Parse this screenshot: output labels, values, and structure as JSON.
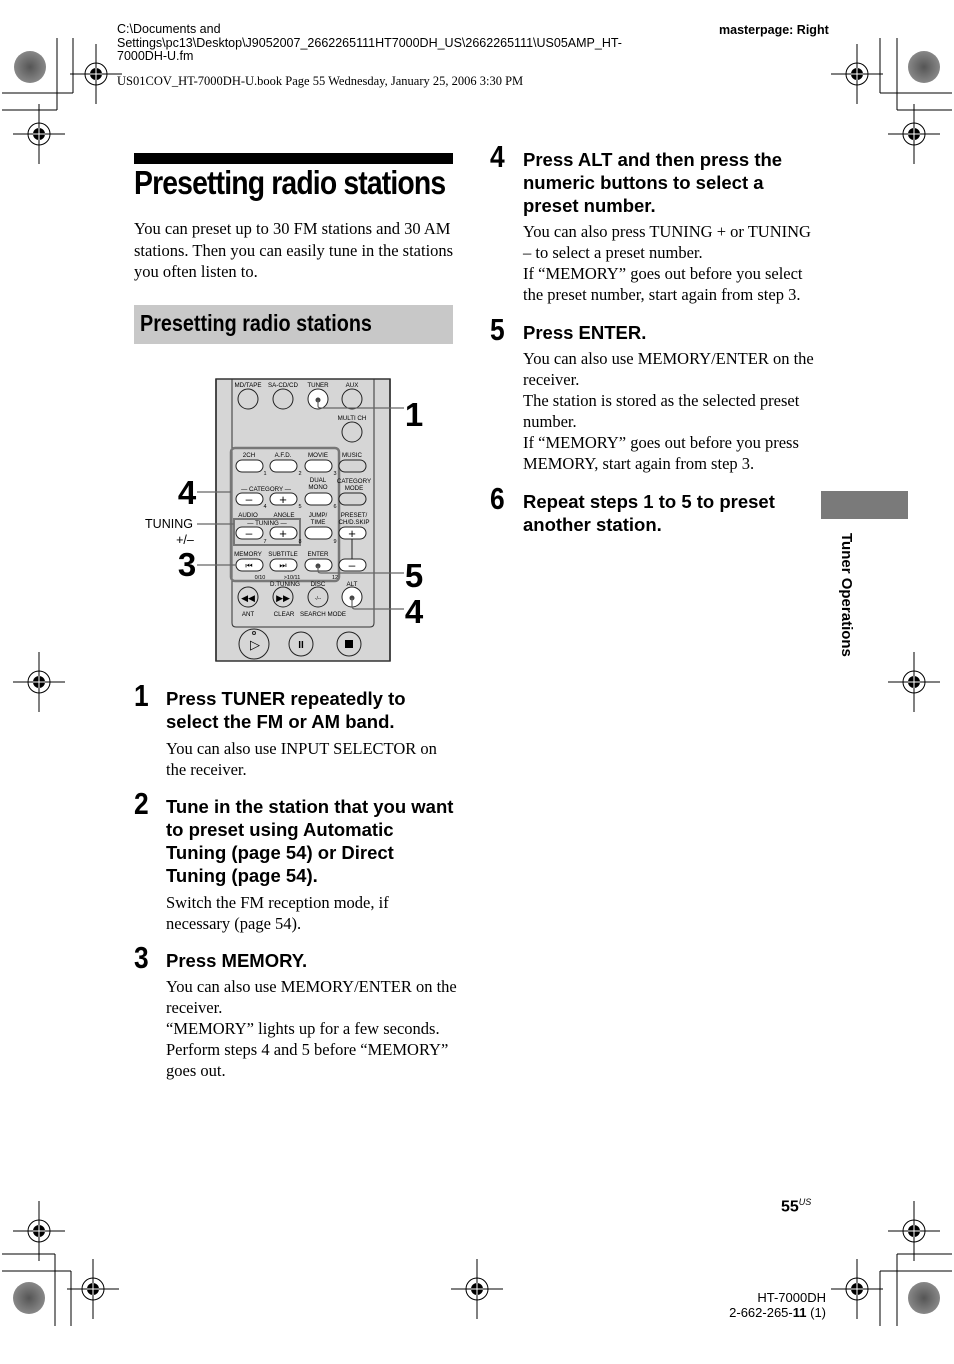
{
  "header": {
    "path_lines": [
      "C:\\Documents and",
      "Settings\\pc13\\Desktop\\J9052007_2662265111HT7000DH_US\\2662265111\\US05AMP_HT-",
      "7000DH-U.fm"
    ],
    "masterpage": "masterpage: Right",
    "book_line": "US01COV_HT-7000DH-U.book  Page 55  Wednesday, January 25, 2006  3:30 PM"
  },
  "page": {
    "title": "Presetting radio stations",
    "intro": "You can preset up to 30 FM stations and 30 AM stations. Then you can easily tune in the stations you often listen to.",
    "subsection_title": "Presetting radio stations",
    "side_tab_label": "Tuner Operations",
    "page_number": "55",
    "page_suffix": "US",
    "model": "HT-7000DH",
    "part_number_prefix": "2-662-265-",
    "part_number_bold": "11",
    "part_number_suffix": " (1)"
  },
  "figure": {
    "callouts": {
      "c1": "1",
      "c4a": "4",
      "c3": "3",
      "c5": "5",
      "c4b": "4",
      "tuning": "TUNING",
      "tuning_sign": "+/–"
    },
    "remote_labels": {
      "mdtape": "MD/TAPE",
      "sacd": "SA-CD/CD",
      "tuner": "TUNER",
      "aux": "AUX",
      "multich": "MULTI CH",
      "ch2": "2CH",
      "afd": "A.F.D.",
      "movie": "MOVIE",
      "music": "MUSIC",
      "category": "— CATEGORY —",
      "dual": "DUAL",
      "mono": "MONO",
      "catmode1": "CATEGORY",
      "catmode2": "MODE",
      "audio": "AUDIO",
      "angle": "ANGLE",
      "jump": "JUMP/",
      "time": "TIME",
      "preset": "PRESET/",
      "chdskip": "CH/D.SKIP",
      "tuning": "— TUNING —",
      "memory": "MEMORY",
      "subtitle": "SUBTITLE",
      "enter": "ENTER",
      "n010": "0/10",
      "n1011": ">10/11",
      "n12": "12",
      "dtuning": "D.TUNING",
      "disc": "DISC",
      "alt": "ALT",
      "ant": "ANT",
      "clear": "CLEAR",
      "searchmode": "SEARCH MODE",
      "d1": "1",
      "d2": "2",
      "d3": "3",
      "d4": "4",
      "d5": "5",
      "d6": "6",
      "d7": "7",
      "d8": "8",
      "d9": "9",
      "plus": "+",
      "minus": "–"
    }
  },
  "steps": [
    {
      "num": "1",
      "head": "Press TUNER repeatedly to select the FM or AM band.",
      "body": "You can also use INPUT SELECTOR on the receiver."
    },
    {
      "num": "2",
      "head": "Tune in the station that you want to preset using Automatic Tuning (page 54) or Direct Tuning (page 54).",
      "body": "Switch the FM reception mode, if necessary (page 54)."
    },
    {
      "num": "3",
      "head": "Press MEMORY.",
      "body": "You can also use MEMORY/ENTER on the receiver.\n“MEMORY” lights up for a few seconds. Perform steps 4 and 5 before “MEMORY” goes out."
    },
    {
      "num": "4",
      "head": "Press ALT and then press the numeric buttons to select a preset number.",
      "body": "You can also press TUNING + or TUNING – to select a preset number.\nIf “MEMORY” goes out before you select the preset number, start again from step 3."
    },
    {
      "num": "5",
      "head": "Press ENTER.",
      "body": "You can also use MEMORY/ENTER on the receiver.\nThe station is stored as the selected preset number.\nIf “MEMORY” goes out before you press MEMORY, start again from step 3."
    },
    {
      "num": "6",
      "head": "Repeat steps 1 to 5 to preset another station.",
      "body": ""
    }
  ]
}
